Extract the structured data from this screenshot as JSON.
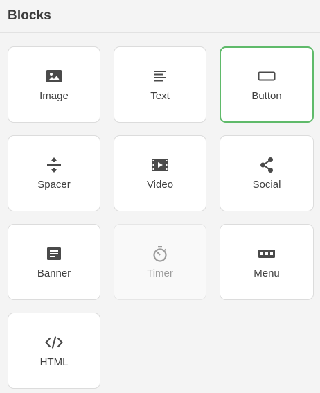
{
  "header": {
    "title": "Blocks"
  },
  "colors": {
    "selected_border": "#5fba6a",
    "icon": "#4a4a4a",
    "icon_disabled": "#9c9c9c"
  },
  "blocks": [
    {
      "label": "Image",
      "icon": "image-icon",
      "state": "normal"
    },
    {
      "label": "Text",
      "icon": "text-icon",
      "state": "normal"
    },
    {
      "label": "Button",
      "icon": "button-icon",
      "state": "selected"
    },
    {
      "label": "Spacer",
      "icon": "spacer-icon",
      "state": "normal"
    },
    {
      "label": "Video",
      "icon": "video-icon",
      "state": "normal"
    },
    {
      "label": "Social",
      "icon": "share-icon",
      "state": "normal"
    },
    {
      "label": "Banner",
      "icon": "banner-icon",
      "state": "normal"
    },
    {
      "label": "Timer",
      "icon": "timer-icon",
      "state": "disabled"
    },
    {
      "label": "Menu",
      "icon": "menu-icon",
      "state": "normal"
    },
    {
      "label": "HTML",
      "icon": "code-icon",
      "state": "normal"
    }
  ]
}
